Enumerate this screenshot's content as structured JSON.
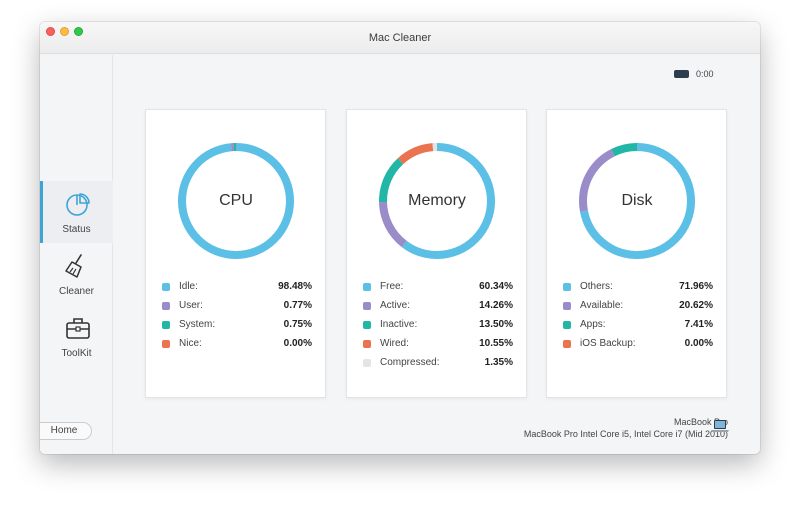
{
  "window": {
    "title": "Mac Cleaner"
  },
  "sidebar": {
    "items": [
      {
        "label": "Status",
        "icon": "pie-chart-icon",
        "active": true
      },
      {
        "label": "Cleaner",
        "icon": "broom-icon",
        "active": false
      },
      {
        "label": "ToolKit",
        "icon": "toolbox-icon",
        "active": false
      }
    ],
    "home_label": "Home"
  },
  "battery": {
    "time": "0:00",
    "icon": "battery-icon"
  },
  "colors": {
    "blue": "#5bbfe6",
    "purple": "#9a8bc9",
    "teal": "#22b6a7",
    "orange": "#ea7350",
    "gray": "#e4e4e4",
    "accent": "#3ea4d6"
  },
  "cards": [
    {
      "title": "CPU",
      "items": [
        {
          "name": "Idle:",
          "value": "98.48%",
          "pct": 98.48,
          "color": "#5bbfe6"
        },
        {
          "name": "User:",
          "value": "0.77%",
          "pct": 0.77,
          "color": "#9a8bc9"
        },
        {
          "name": "System:",
          "value": "0.75%",
          "pct": 0.75,
          "color": "#22b6a7"
        },
        {
          "name": "Nice:",
          "value": "0.00%",
          "pct": 0.0,
          "color": "#ea7350"
        }
      ]
    },
    {
      "title": "Memory",
      "items": [
        {
          "name": "Free:",
          "value": "60.34%",
          "pct": 60.34,
          "color": "#5bbfe6"
        },
        {
          "name": "Active:",
          "value": "14.26%",
          "pct": 14.26,
          "color": "#9a8bc9"
        },
        {
          "name": "Inactive:",
          "value": "13.50%",
          "pct": 13.5,
          "color": "#22b6a7"
        },
        {
          "name": "Wired:",
          "value": "10.55%",
          "pct": 10.55,
          "color": "#ea7350"
        },
        {
          "name": "Compressed:",
          "value": "1.35%",
          "pct": 1.35,
          "color": "#e4e4e4"
        }
      ]
    },
    {
      "title": "Disk",
      "items": [
        {
          "name": "Others:",
          "value": "71.96%",
          "pct": 71.96,
          "color": "#5bbfe6"
        },
        {
          "name": "Available:",
          "value": "20.62%",
          "pct": 20.62,
          "color": "#9a8bc9"
        },
        {
          "name": "Apps:",
          "value": "7.41%",
          "pct": 7.41,
          "color": "#22b6a7"
        },
        {
          "name": "iOS Backup:",
          "value": "0.00%",
          "pct": 0.0,
          "color": "#ea7350"
        }
      ]
    }
  ],
  "machine": {
    "name": "MacBook Pro",
    "model": "MacBook Pro Intel Core i5, Intel Core i7 (Mid 2010)",
    "icon": "laptop-icon"
  }
}
